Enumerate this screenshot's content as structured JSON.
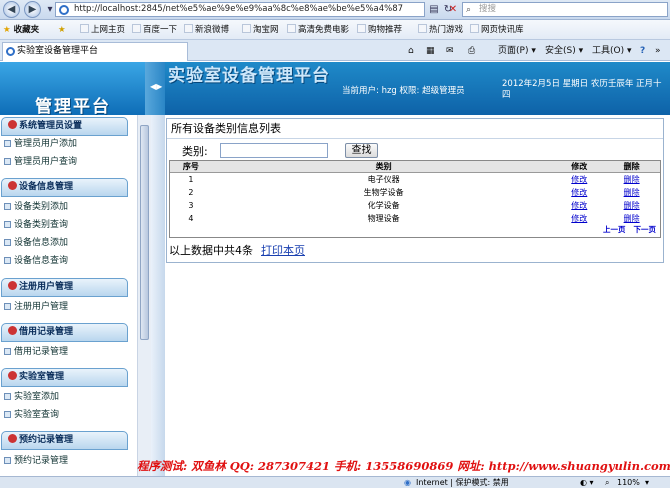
{
  "browser": {
    "url": "http://localhost:2845/net%e5%ae%9e%e9%aa%8c%e8%ae%be%e5%a4%87",
    "search_placeholder": "搜搜",
    "favorites_label": "收藏夹",
    "favorites": [
      "上网主页",
      "百度一下",
      "新浪微博",
      "淘宝网",
      "高清免费电影",
      "购物推荐",
      "热门游戏",
      "网页快讯库"
    ],
    "tab_title": "实验室设备管理平台",
    "commands": [
      "页面(P)",
      "安全(S)",
      "工具(O)"
    ],
    "status": {
      "zone": "Internet | 保护模式: 禁用",
      "zoom": "110%"
    }
  },
  "header": {
    "platform_label": "管理平台",
    "system_title": "实验室设备管理平台",
    "user_info": "当前用户: hzg  权限: 超级管理员",
    "date_info": "2012年2月5日 星期日 农历壬辰年 正月十四"
  },
  "sidebar": {
    "sections": [
      {
        "title": "系统管理员设置",
        "items": [
          "管理员用户添加",
          "管理员用户查询"
        ]
      },
      {
        "title": "设备信息管理",
        "items": [
          "设备类别添加",
          "设备类别查询",
          "设备信息添加",
          "设备信息查询"
        ]
      },
      {
        "title": "注册用户管理",
        "items": [
          "注册用户管理"
        ]
      },
      {
        "title": "借用记录管理",
        "items": [
          "借用记录管理"
        ]
      },
      {
        "title": "实验室管理",
        "items": [
          "实验室添加",
          "实验室查询"
        ]
      },
      {
        "title": "预约记录管理",
        "items": [
          "预约记录管理"
        ]
      }
    ]
  },
  "main": {
    "panel_title": "所有设备类别信息列表",
    "filter_label": "类别:",
    "filter_value": "",
    "search_button": "查找",
    "table": {
      "headers": [
        "序号",
        "类别",
        "修改",
        "删除"
      ],
      "rows": [
        [
          "1",
          "电子仪器",
          "修改",
          "删除"
        ],
        [
          "2",
          "生物学设备",
          "修改",
          "删除"
        ],
        [
          "3",
          "化学设备",
          "修改",
          "删除"
        ],
        [
          "4",
          "物理设备",
          "修改",
          "删除"
        ]
      ]
    },
    "pager": {
      "prev": "上一页",
      "next": "下一页"
    },
    "summary": "以上数据中共4条",
    "print_link": "打印本页"
  },
  "footer": {
    "credits": "程序测试: 双鱼林    QQ: 287307421    手机: 13558690869    网址: http://www.shuangyulin.com"
  }
}
